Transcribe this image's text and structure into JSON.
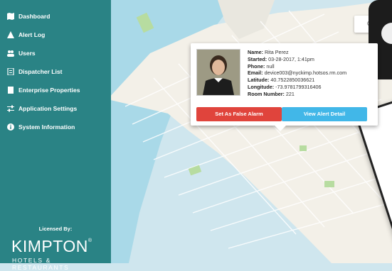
{
  "sidebar": {
    "items": [
      {
        "label": "Dashboard",
        "icon": "map-icon"
      },
      {
        "label": "Alert Log",
        "icon": "warning-icon"
      },
      {
        "label": "Users",
        "icon": "users-icon"
      },
      {
        "label": "Dispatcher List",
        "icon": "list-icon"
      },
      {
        "label": "Enterprise Properties",
        "icon": "building-icon"
      },
      {
        "label": "Application Settings",
        "icon": "sliders-icon"
      },
      {
        "label": "System Information",
        "icon": "info-icon"
      }
    ],
    "licensed_by": "Licensed By:",
    "brand": "KIMPTON",
    "brand_sub": "HOTELS & RESTAURANTS"
  },
  "map": {
    "control_label": "Cur"
  },
  "popup": {
    "name_label": "Name:",
    "name": "Rita Perez",
    "started_label": "Started:",
    "started": "03-28-2017, 1:41pm",
    "phone_label": "Phone:",
    "phone": "null",
    "email_label": "Email:",
    "email": "device003@nyckimp.hotsos.rm.com",
    "latitude_label": "Latitude:",
    "latitude": "40.7522850036621",
    "longitude_label": "Longitude:",
    "longitude": "-73.9781799316406",
    "room_label": "Room Number:",
    "room": "221",
    "false_alarm_button": "Set As False Alarm",
    "view_detail_button": "View Alert Detail"
  },
  "colors": {
    "sidebar": "#2a8385",
    "false_alarm": "#e0443c",
    "view_detail": "#41b7e8"
  }
}
